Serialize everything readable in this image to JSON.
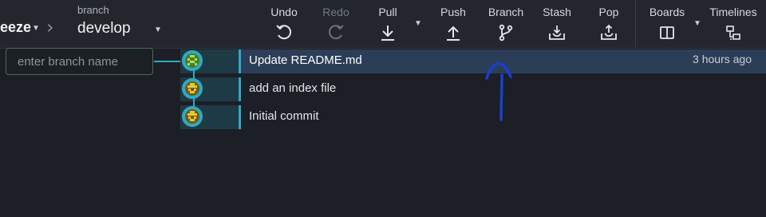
{
  "header": {
    "repo_name": "eeze",
    "branch_caption": "branch",
    "branch_name": "develop"
  },
  "toolbar": {
    "undo": "Undo",
    "redo": "Redo",
    "pull": "Pull",
    "push": "Push",
    "branch": "Branch",
    "stash": "Stash",
    "pop": "Pop",
    "boards": "Boards",
    "timelines": "Timelines"
  },
  "branch_input": {
    "placeholder": "enter branch name",
    "value": ""
  },
  "commits": [
    {
      "message": "Update README.md",
      "time": "3 hours ago",
      "selected": true
    },
    {
      "message": "add an index file",
      "time": "",
      "selected": false
    },
    {
      "message": "Initial commit",
      "time": "",
      "selected": false
    }
  ],
  "colors": {
    "accent": "#2eaac3",
    "selected_row": "#2c3d57",
    "annotation": "#1a3fd1"
  }
}
